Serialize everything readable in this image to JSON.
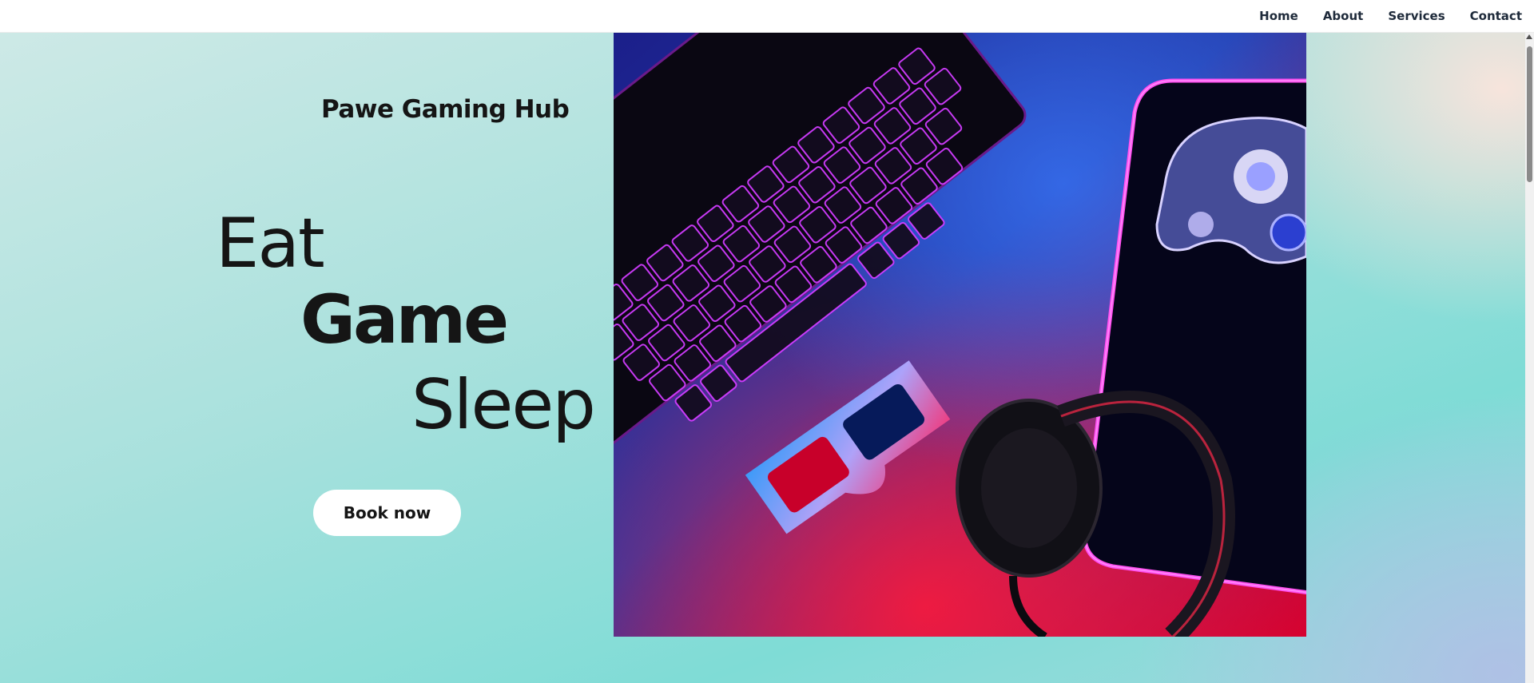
{
  "nav": {
    "items": [
      {
        "label": "Home"
      },
      {
        "label": "About"
      },
      {
        "label": "Services"
      },
      {
        "label": "Contact"
      }
    ]
  },
  "hero": {
    "brand": "Pawe Gaming Hub",
    "word_eat": "Eat",
    "word_game": "Game",
    "word_sleep": "Sleep",
    "cta_label": "Book now",
    "image_icon": "gaming-setup-photo"
  },
  "colors": {
    "accent_neon_pink": "#ff2bd6",
    "accent_neon_blue": "#2b6bff",
    "text": "#151515"
  }
}
